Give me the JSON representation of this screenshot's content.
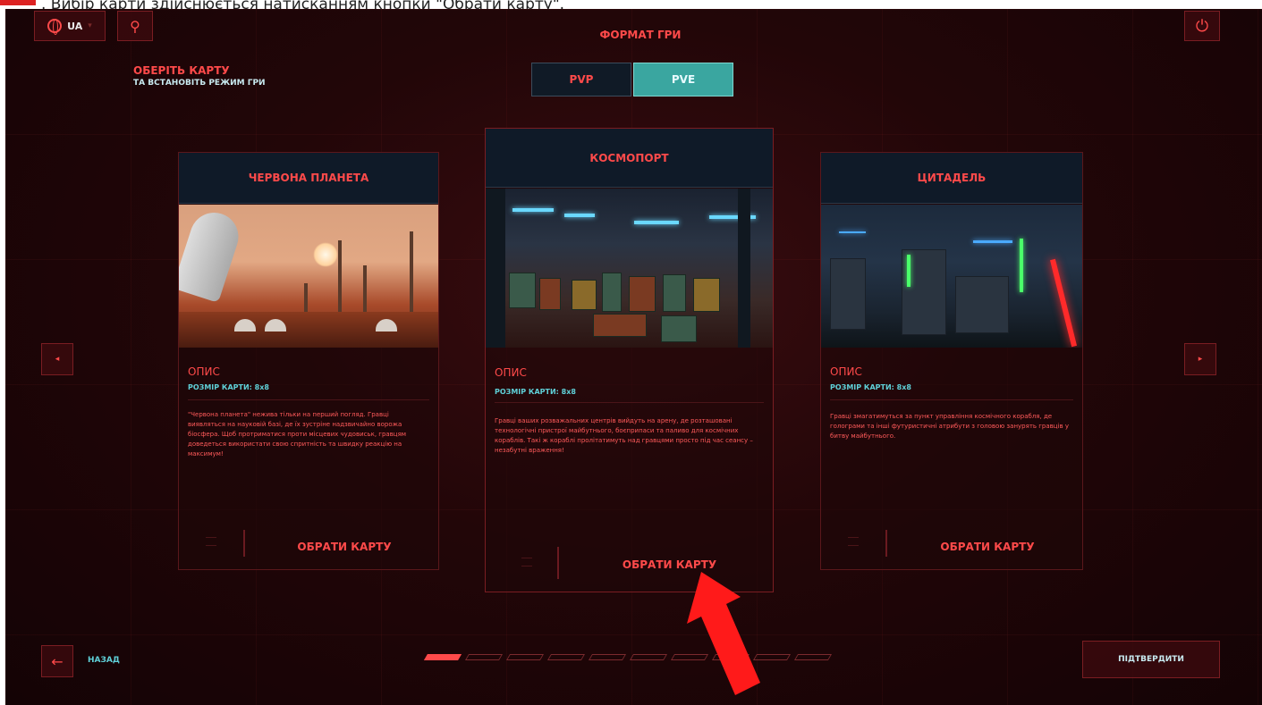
{
  "caption": {
    "text": ". Вибір карти здійснюється натисканням кнопки \"Обрати карту\"."
  },
  "header": {
    "language": "UA",
    "format_label": "ФОРМАТ ГРИ",
    "modes": [
      {
        "label": "PVP",
        "selected": false
      },
      {
        "label": "PVE",
        "selected": true
      }
    ],
    "choose_title": "ОБЕРІТЬ КАРТУ",
    "choose_subtitle": "ТА ВСТАНОВІТЬ РЕЖИМ ГРИ"
  },
  "cards": [
    {
      "title": "ЧЕРВОНА ПЛАНЕТА",
      "desc_title": "ОПИС",
      "size": "РОЗМІР КАРТИ: 8x8",
      "body": "\"Червона планета\" нежива тільки на перший погляд. Гравці виявляться на науковій базі, де їх зустріне надзвичайно ворожа біосфера. Щоб протриматися проти місцевих чудовиськ, гравцям доведеться використати свою спритність та швидку реакцію на максимум!",
      "button": "ОБРАТИ КАРТУ"
    },
    {
      "title": "КОСМОПОРТ",
      "desc_title": "ОПИС",
      "size": "РОЗМІР КАРТИ: 8x8",
      "body": "Гравці ваших розважальних центрів вийдуть на арену, де розташовані технологічні пристрої майбутнього, боєприпаси та паливо для космічних кораблів. Такі ж кораблі пролітатимуть над гравцями просто під час сеансу – незабутні враження!",
      "button": "ОБРАТИ КАРТУ"
    },
    {
      "title": "ЦИТАДЕЛЬ",
      "desc_title": "ОПИС",
      "size": "РОЗМІР КАРТИ: 8x8",
      "body": "Гравці змагатимуться за пункт управління космічного корабля, де голограми та інші футуристичні атрибути з головою занурять гравців у битву майбутнього.",
      "button": "ОБРАТИ КАРТУ"
    }
  ],
  "footer": {
    "back_label": "НАЗАД",
    "confirm_label": "ПІДТВЕРДИТИ",
    "pages_total": 10,
    "page_current": 1
  },
  "colors": {
    "accent_red": "#ff4a4a",
    "accent_teal": "#3aa6a0",
    "text_cyan": "#5fd0d8",
    "annotation_arrow": "#ff1a1a"
  },
  "icons": {
    "language": "globe-icon",
    "pin": "pin-icon",
    "power": "power-icon",
    "back": "arrow-left-icon",
    "prev": "chevron-left-icon",
    "next": "chevron-right-icon",
    "annotation": "red-arrow-icon"
  }
}
